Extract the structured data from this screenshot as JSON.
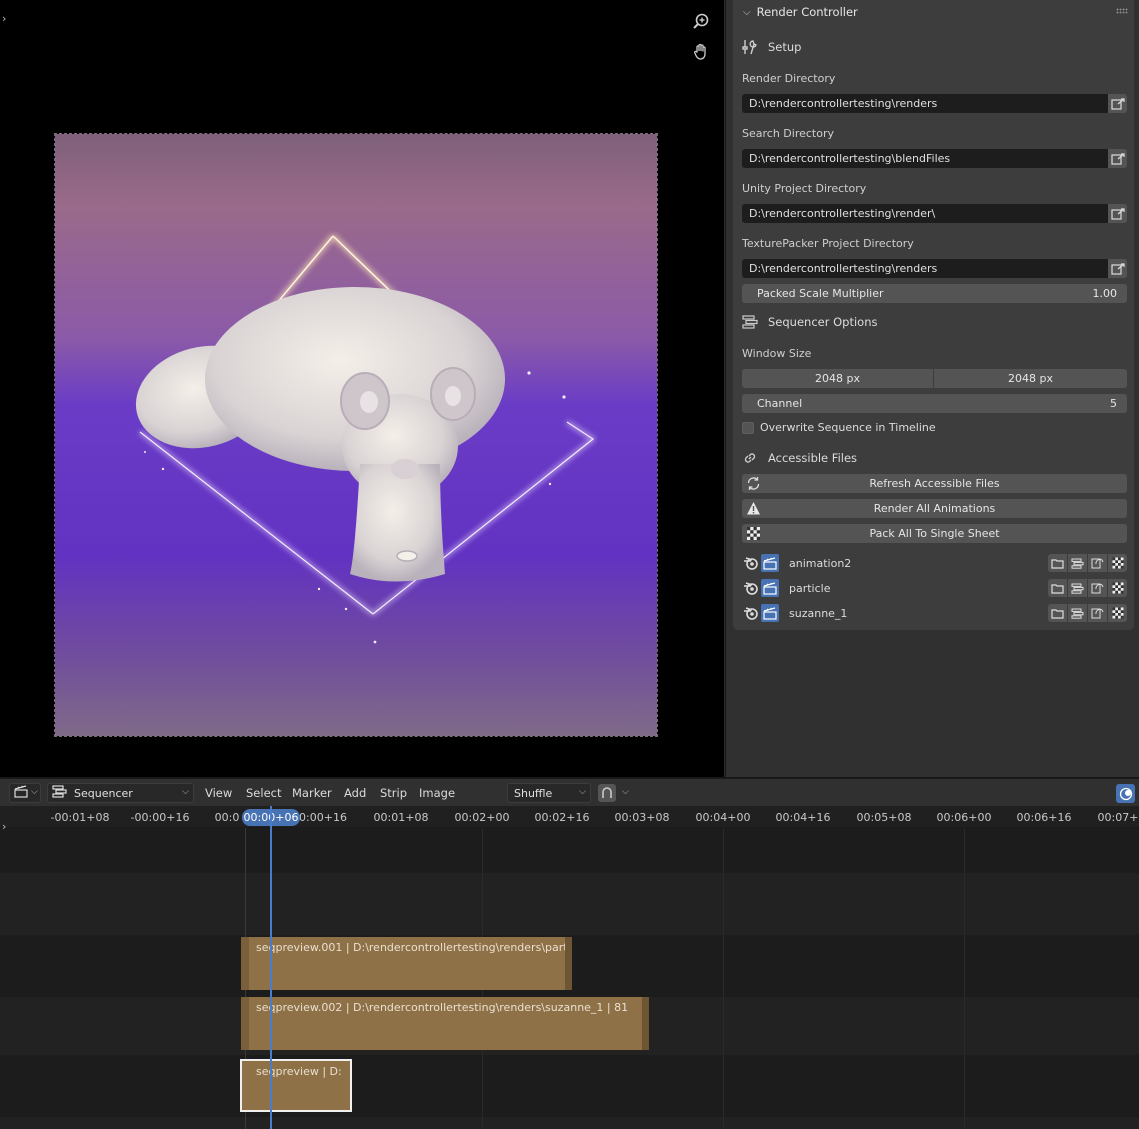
{
  "panel": {
    "title": "Render Controller",
    "setup_label": "Setup",
    "render_dir_label": "Render Directory",
    "render_dir_value": "D:\\rendercontrollertesting\\renders",
    "search_dir_label": "Search Directory",
    "search_dir_value": "D:\\rendercontrollertesting\\blendFiles",
    "unity_dir_label": "Unity Project Directory",
    "unity_dir_value": "D:\\rendercontrollertesting\\render\\",
    "tp_dir_label": "TexturePacker Project Directory",
    "tp_dir_value": "D:\\rendercontrollertesting\\renders",
    "packed_scale_label": "Packed Scale Multiplier",
    "packed_scale_value": "1.00",
    "seq_options_label": "Sequencer Options",
    "window_size_label": "Window Size",
    "window_w": "2048 px",
    "window_h": "2048 px",
    "channel_label": "Channel",
    "channel_value": "5",
    "overwrite_label": "Overwrite Sequence in Timeline",
    "accessible_label": "Accessible Files",
    "refresh_btn": "Refresh Accessible Files",
    "render_all_btn": "Render All Animations",
    "pack_all_btn": "Pack All To Single Sheet",
    "animations": [
      {
        "name": "animation2"
      },
      {
        "name": "particle"
      },
      {
        "name": "suzanne_1"
      }
    ]
  },
  "sequencer": {
    "editor_type": "Sequencer",
    "menus": [
      "View",
      "Select",
      "Marker",
      "Add",
      "Strip",
      "Image"
    ],
    "overlap_mode": "Shuffle",
    "current_time": "00:00+06",
    "ruler_ticks": [
      "-00:01+08",
      "-00:00+16",
      "00:0",
      "0:00+16",
      "00:01+08",
      "00:02+00",
      "00:02+16",
      "00:03+08",
      "00:04+00",
      "00:04+16",
      "00:05+08",
      "00:06+00",
      "00:06+16",
      "00:07+"
    ],
    "strips": [
      {
        "label": "seqpreview.001 | D:\\rendercontrollertesting\\renders\\parti"
      },
      {
        "label": "seqpreview.002 | D:\\rendercontrollertesting\\renders\\suzanne_1 | 81"
      },
      {
        "label": "seqpreview | D:"
      }
    ]
  },
  "colors": {
    "accent": "#4772b3",
    "strip": "#8f7147",
    "panel_bg": "#3d3d3d"
  }
}
